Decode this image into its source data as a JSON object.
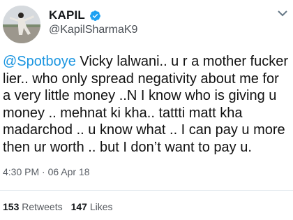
{
  "author": {
    "display_name": "KAPIL",
    "handle": "@KapilSharmaK9"
  },
  "tweet": {
    "mention": "@Spotboye",
    "body": " Vicky lalwani.. u r a mother fucker lier.. who only spread negativity about me for a very little money ..N I know who is giving u money .. mehnat ki kha.. tattti matt kha madarchod .. u know what ..  I can pay u more then ur worth .. but I don’t want to pay u."
  },
  "timestamp": "4:30 PM · 06 Apr 18",
  "stats": {
    "retweets_count": "153",
    "retweets_label": "Retweets",
    "likes_count": "147",
    "likes_label": "Likes"
  },
  "colors": {
    "link": "#1b95e0",
    "verified": "#1da1f2"
  },
  "icons": {
    "verified": "verified-badge-icon",
    "menu": "chevron-down-icon"
  }
}
